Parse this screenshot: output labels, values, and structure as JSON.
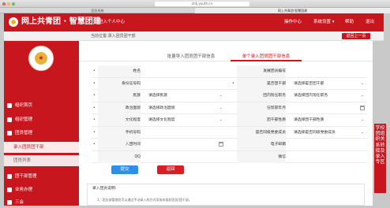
{
  "browser": {
    "url": "zhtj.youth.cn",
    "tabs": [
      "团员系统",
      "网上共青团·智慧团建"
    ]
  },
  "header": {
    "brand": "网上共青团 · 智慧团建",
    "subtitle": "进入个人中心",
    "nav": [
      "操作中心",
      "系统设置 ▾",
      "帮助",
      "退出"
    ]
  },
  "breadcrumb": "当前位置:录入团员团干部",
  "back_button": "返回上一页",
  "sidebar": {
    "items": [
      "组织首页",
      "组织管理",
      "团员管理",
      "录入团员团干部",
      "团员列表",
      "团干部管理",
      "业务办理",
      "三会"
    ]
  },
  "form_tabs": [
    "批量导入团员团干部信息",
    "单个录入团员团干部信息"
  ],
  "form": {
    "rows": [
      {
        "l_label": "姓名",
        "l_req": true,
        "l_val": "",
        "l_type": "text",
        "r_label": "发展团员编号",
        "r_req": false,
        "r_val": "",
        "r_type": "text"
      },
      {
        "l_label": "身份证号码",
        "l_req": true,
        "l_val": "",
        "l_type": "text",
        "r_label": "是否团干部",
        "r_req": true,
        "r_val": "请选择是否团干部",
        "r_type": "select"
      },
      {
        "l_label": "民族",
        "l_req": true,
        "l_val": "请选择民族",
        "l_type": "select",
        "r_label": "团内现任职务",
        "r_req": false,
        "r_val": "请选择团内现任职务",
        "r_type": "select"
      },
      {
        "l_label": "政治面貌",
        "l_req": true,
        "l_val": "请选择政治面貌",
        "l_type": "select",
        "r_label": "任现职年月",
        "r_req": false,
        "r_val": "",
        "r_type": "date"
      },
      {
        "l_label": "文化程度",
        "l_req": true,
        "l_val": "请选择文化程度",
        "l_type": "select",
        "r_label": "团干部性质",
        "r_req": false,
        "r_val": "请选择团干部性质",
        "r_type": "select"
      },
      {
        "l_label": "手机号码",
        "l_req": true,
        "l_val": "",
        "l_type": "text",
        "r_label": "是否同级党委成员",
        "r_req": false,
        "r_val": "请选择是否同级党委成员",
        "r_type": "select"
      },
      {
        "l_label": "入团时间",
        "l_req": true,
        "l_val": "",
        "l_type": "date",
        "r_label": "电子邮箱",
        "r_req": false,
        "r_val": "",
        "r_type": "text"
      },
      {
        "l_label": "QQ",
        "l_req": false,
        "l_val": "",
        "l_type": "text",
        "r_label": "微信",
        "r_req": false,
        "r_val": "",
        "r_type": "text"
      }
    ]
  },
  "buttons": {
    "submit": "提交",
    "return": "返回"
  },
  "notes": {
    "title": "录入团员说明:",
    "line1": "1、团支部管理员可以通过手动录入的方式添加本组织团员/团干部。"
  },
  "float_tab": "学校团组织关系转接及录入专区",
  "colors": {
    "brand_red": "#c8161e",
    "submit_blue": "#2d8fe8",
    "return_red": "#d41f26",
    "gold": "#e7b23a"
  }
}
